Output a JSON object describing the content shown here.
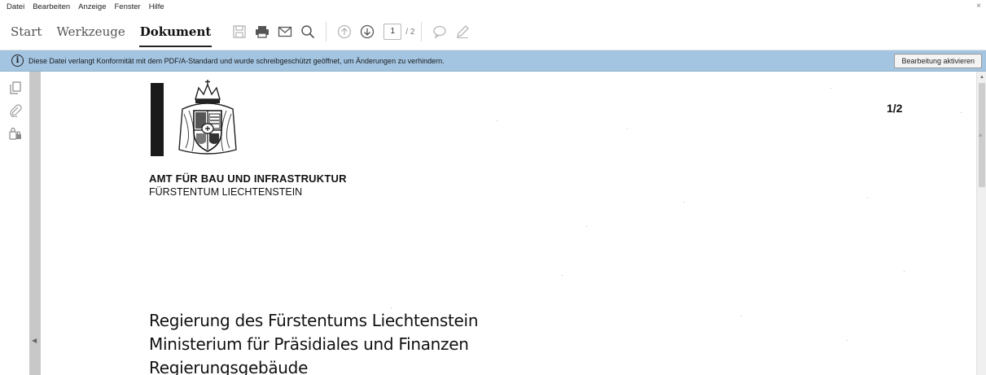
{
  "menubar": {
    "items": [
      "Datei",
      "Bearbeiten",
      "Anzeige",
      "Fenster",
      "Hilfe"
    ],
    "close": "×"
  },
  "toolbar": {
    "tabs": [
      "Start",
      "Werkzeuge",
      "Dokument"
    ],
    "active_tab": "Dokument",
    "icons": [
      "save-icon",
      "print-icon",
      "mail-icon",
      "search-icon",
      "page-up-icon",
      "page-down-icon",
      "comment-icon",
      "pen-icon"
    ],
    "page_current": "1",
    "page_total": "/ 2"
  },
  "infobar": {
    "message": "Diese Datei verlangt Konformität mit dem PDF/A-Standard und wurde schreibgeschützt geöffnet, um Änderungen zu verhindern.",
    "button_label": "Bearbeitung aktivieren",
    "icon": "info-icon"
  },
  "leftrail": {
    "icons": [
      "pages-icon",
      "attachment-icon",
      "security-lock-icon"
    ]
  },
  "document": {
    "org_name": "AMT FÜR BAU UND INFRASTRUKTUR",
    "org_sub": "FÜRSTENTUM LIECHTENSTEIN",
    "page_number": "1/2",
    "address_line_1": "Regierung des Fürstentums Liechtenstein",
    "address_line_2": "Ministerium für Präsidiales und Finanzen",
    "address_line_3": "Regierungsgebäude"
  },
  "colors": {
    "infobar_bg": "#a3c5e2",
    "doc_area_bg": "#d3d3d3",
    "page_bg": "#ffffff"
  }
}
